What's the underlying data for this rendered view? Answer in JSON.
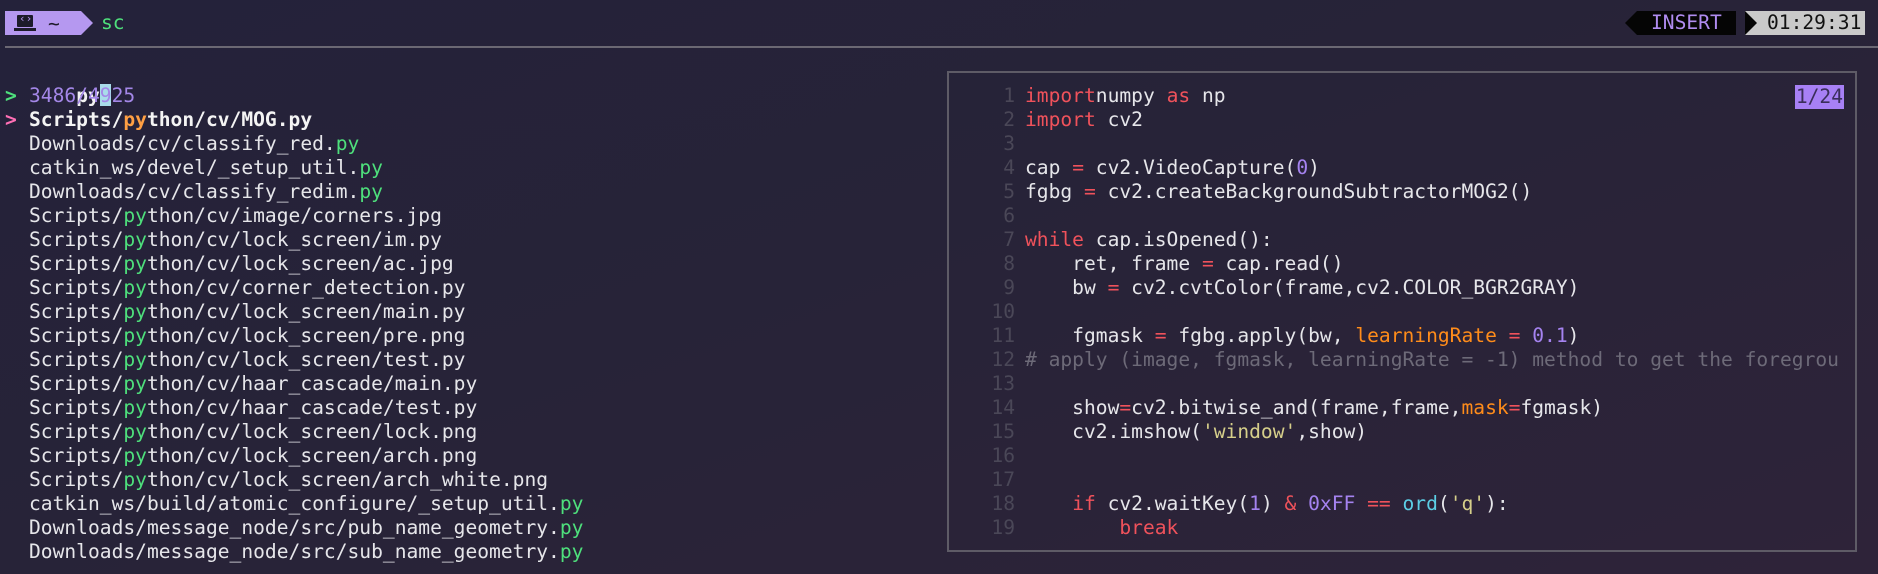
{
  "topbar": {
    "directory": "~",
    "command": "sc",
    "mode": "INSERT",
    "clock": "01:29:31",
    "icon": "laptop-code-icon"
  },
  "finder": {
    "prompt_marker": ">",
    "query": "py",
    "count": "3486/4925",
    "selected_marker": ">",
    "results": [
      {
        "pre": "Scripts/",
        "match": "py",
        "post": "thon/cv/MOG.py",
        "selected": true
      },
      {
        "pre": "Downloads/cv/classify_red.",
        "match": "py",
        "post": ""
      },
      {
        "pre": "catkin_ws/devel/_setup_util.",
        "match": "py",
        "post": ""
      },
      {
        "pre": "Downloads/cv/classify_redim.",
        "match": "py",
        "post": ""
      },
      {
        "pre": "Scripts/",
        "match": "py",
        "post": "thon/cv/image/corners.jpg"
      },
      {
        "pre": "Scripts/",
        "match": "py",
        "post": "thon/cv/lock_screen/im.py"
      },
      {
        "pre": "Scripts/",
        "match": "py",
        "post": "thon/cv/lock_screen/ac.jpg"
      },
      {
        "pre": "Scripts/",
        "match": "py",
        "post": "thon/cv/corner_detection.py"
      },
      {
        "pre": "Scripts/",
        "match": "py",
        "post": "thon/cv/lock_screen/main.py"
      },
      {
        "pre": "Scripts/",
        "match": "py",
        "post": "thon/cv/lock_screen/pre.png"
      },
      {
        "pre": "Scripts/",
        "match": "py",
        "post": "thon/cv/lock_screen/test.py"
      },
      {
        "pre": "Scripts/",
        "match": "py",
        "post": "thon/cv/haar_cascade/main.py"
      },
      {
        "pre": "Scripts/",
        "match": "py",
        "post": "thon/cv/haar_cascade/test.py"
      },
      {
        "pre": "Scripts/",
        "match": "py",
        "post": "thon/cv/lock_screen/lock.png"
      },
      {
        "pre": "Scripts/",
        "match": "py",
        "post": "thon/cv/lock_screen/arch.png"
      },
      {
        "pre": "Scripts/",
        "match": "py",
        "post": "thon/cv/lock_screen/arch_white.png"
      },
      {
        "pre": "catkin_ws/build/atomic_configure/_setup_util.",
        "match": "py",
        "post": ""
      },
      {
        "pre": "Downloads/message_node/src/pub_name_geometry.",
        "match": "py",
        "post": ""
      },
      {
        "pre": "Downloads/message_node/src/sub_name_geometry.",
        "match": "py",
        "post": ""
      }
    ]
  },
  "preview": {
    "position": "1/24",
    "lines": [
      {
        "n": "1",
        "t": [
          [
            "kw",
            "import"
          ],
          [
            "",
            "numpy "
          ],
          [
            "kw",
            "as"
          ],
          [
            "",
            " np"
          ]
        ]
      },
      {
        "n": "2",
        "t": [
          [
            "kw",
            "import"
          ],
          [
            "",
            " cv2"
          ]
        ]
      },
      {
        "n": "3",
        "t": []
      },
      {
        "n": "4",
        "t": [
          [
            "",
            "cap "
          ],
          [
            "op",
            "="
          ],
          [
            "",
            " cv2.VideoCapture("
          ],
          [
            "num",
            "0"
          ],
          [
            "",
            ")"
          ]
        ]
      },
      {
        "n": "5",
        "t": [
          [
            "",
            "fgbg "
          ],
          [
            "op",
            "="
          ],
          [
            "",
            " cv2.createBackgroundSubtractorMOG2()"
          ]
        ]
      },
      {
        "n": "6",
        "t": []
      },
      {
        "n": "7",
        "t": [
          [
            "kw",
            "while"
          ],
          [
            "",
            " cap.isOpened():"
          ]
        ]
      },
      {
        "n": "8",
        "t": [
          [
            "",
            "    ret, frame "
          ],
          [
            "op",
            "="
          ],
          [
            "",
            " cap.read()"
          ]
        ]
      },
      {
        "n": "9",
        "t": [
          [
            "",
            "    bw "
          ],
          [
            "op",
            "="
          ],
          [
            "",
            " cv2.cvtColor(frame,cv2.COLOR_BGR2GRAY)"
          ]
        ]
      },
      {
        "n": "10",
        "t": []
      },
      {
        "n": "11",
        "t": [
          [
            "",
            "    fgmask "
          ],
          [
            "op",
            "="
          ],
          [
            "",
            " fgbg.apply(bw, "
          ],
          [
            "arg",
            "learningRate"
          ],
          [
            "",
            " "
          ],
          [
            "op",
            "="
          ],
          [
            "",
            " "
          ],
          [
            "num",
            "0.1"
          ],
          [
            "",
            ")"
          ]
        ]
      },
      {
        "n": "12",
        "t": [
          [
            "cm",
            "# apply (image, fgmask, learningRate = -1) method to get the foregrou"
          ]
        ]
      },
      {
        "n": "13",
        "t": []
      },
      {
        "n": "14",
        "t": [
          [
            "",
            "    show"
          ],
          [
            "op",
            "="
          ],
          [
            "",
            "cv2.bitwise_and(frame,frame,"
          ],
          [
            "arg",
            "mask"
          ],
          [
            "op",
            "="
          ],
          [
            "",
            "fgmask)"
          ]
        ]
      },
      {
        "n": "15",
        "t": [
          [
            "",
            "    cv2.imshow("
          ],
          [
            "str",
            "'window'"
          ],
          [
            "",
            ",show)"
          ]
        ]
      },
      {
        "n": "16",
        "t": []
      },
      {
        "n": "17",
        "t": []
      },
      {
        "n": "18",
        "t": [
          [
            "",
            "    "
          ],
          [
            "kw",
            "if"
          ],
          [
            "",
            " cv2.waitKey("
          ],
          [
            "num",
            "1"
          ],
          [
            "",
            ") "
          ],
          [
            "op",
            "&"
          ],
          [
            "",
            " "
          ],
          [
            "num",
            "0xFF"
          ],
          [
            "",
            " "
          ],
          [
            "op",
            "=="
          ],
          [
            "",
            " "
          ],
          [
            "fn",
            "ord"
          ],
          [
            "",
            "("
          ],
          [
            "str",
            "'q'"
          ],
          [
            "",
            "):"
          ]
        ]
      },
      {
        "n": "19",
        "t": [
          [
            "",
            "        "
          ],
          [
            "kw",
            "break"
          ]
        ]
      }
    ]
  }
}
